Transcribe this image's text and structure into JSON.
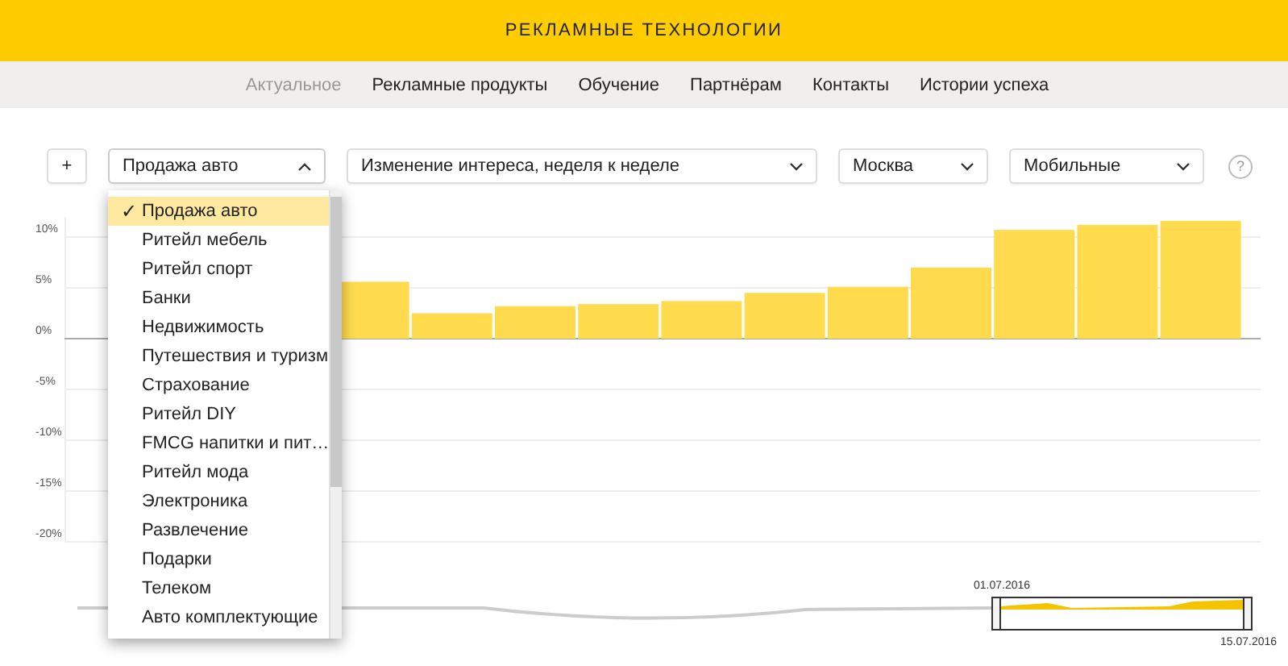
{
  "header": {
    "title": "РЕКЛАМНЫЕ ТЕХНОЛОГИИ"
  },
  "nav": {
    "items": [
      {
        "label": "Актуальное",
        "selected": true
      },
      {
        "label": "Рекламные продукты",
        "selected": false
      },
      {
        "label": "Обучение",
        "selected": false
      },
      {
        "label": "Партнёрам",
        "selected": false
      },
      {
        "label": "Контакты",
        "selected": false
      },
      {
        "label": "Истории успеха",
        "selected": false
      }
    ]
  },
  "toolbar": {
    "add_button": "+",
    "selects": [
      {
        "value": "Продажа авто",
        "open": true
      },
      {
        "value": "Изменение интереса, неделя к неделе",
        "open": false
      },
      {
        "value": "Москва",
        "open": false
      },
      {
        "value": "Мобильные",
        "open": false
      }
    ],
    "help": "?"
  },
  "dropdown": {
    "check_mark": "✓",
    "options": [
      {
        "label": "Продажа авто",
        "selected": true
      },
      {
        "label": "Ритейл мебель",
        "selected": false
      },
      {
        "label": "Ритейл спорт",
        "selected": false
      },
      {
        "label": "Банки",
        "selected": false
      },
      {
        "label": "Недвижимость",
        "selected": false
      },
      {
        "label": "Путешествия и туризм",
        "selected": false
      },
      {
        "label": "Страхование",
        "selected": false
      },
      {
        "label": "Ритейл DIY",
        "selected": false
      },
      {
        "label": "FMCG напитки и пит…",
        "selected": false
      },
      {
        "label": "Ритейл мода",
        "selected": false
      },
      {
        "label": "Электроника",
        "selected": false
      },
      {
        "label": "Развлечение",
        "selected": false
      },
      {
        "label": "Подарки",
        "selected": false
      },
      {
        "label": "Телеком",
        "selected": false
      },
      {
        "label": "Авто комплектующие",
        "selected": false
      }
    ]
  },
  "chart": {
    "chart_data": {
      "type": "bar",
      "grid": true,
      "ylim": [
        -20,
        12
      ],
      "yticks": [
        {
          "value": 10,
          "label": "10%"
        },
        {
          "value": 5,
          "label": "5%"
        },
        {
          "value": 0,
          "label": "0%"
        },
        {
          "value": -5,
          "label": "-5%"
        },
        {
          "value": -10,
          "label": "-10%"
        },
        {
          "value": -15,
          "label": "-15%"
        },
        {
          "value": -20,
          "label": "-20%"
        }
      ],
      "series": [
        {
          "color": "#ffdb4d",
          "values": [
            null,
            null,
            null,
            5.6,
            2.5,
            3.2,
            3.4,
            3.7,
            4.5,
            5.1,
            7.0,
            10.7,
            11.2,
            11.6
          ]
        }
      ]
    }
  },
  "navigator": {
    "start_date": "01.07.2016",
    "end_date": "15.07.2016"
  }
}
